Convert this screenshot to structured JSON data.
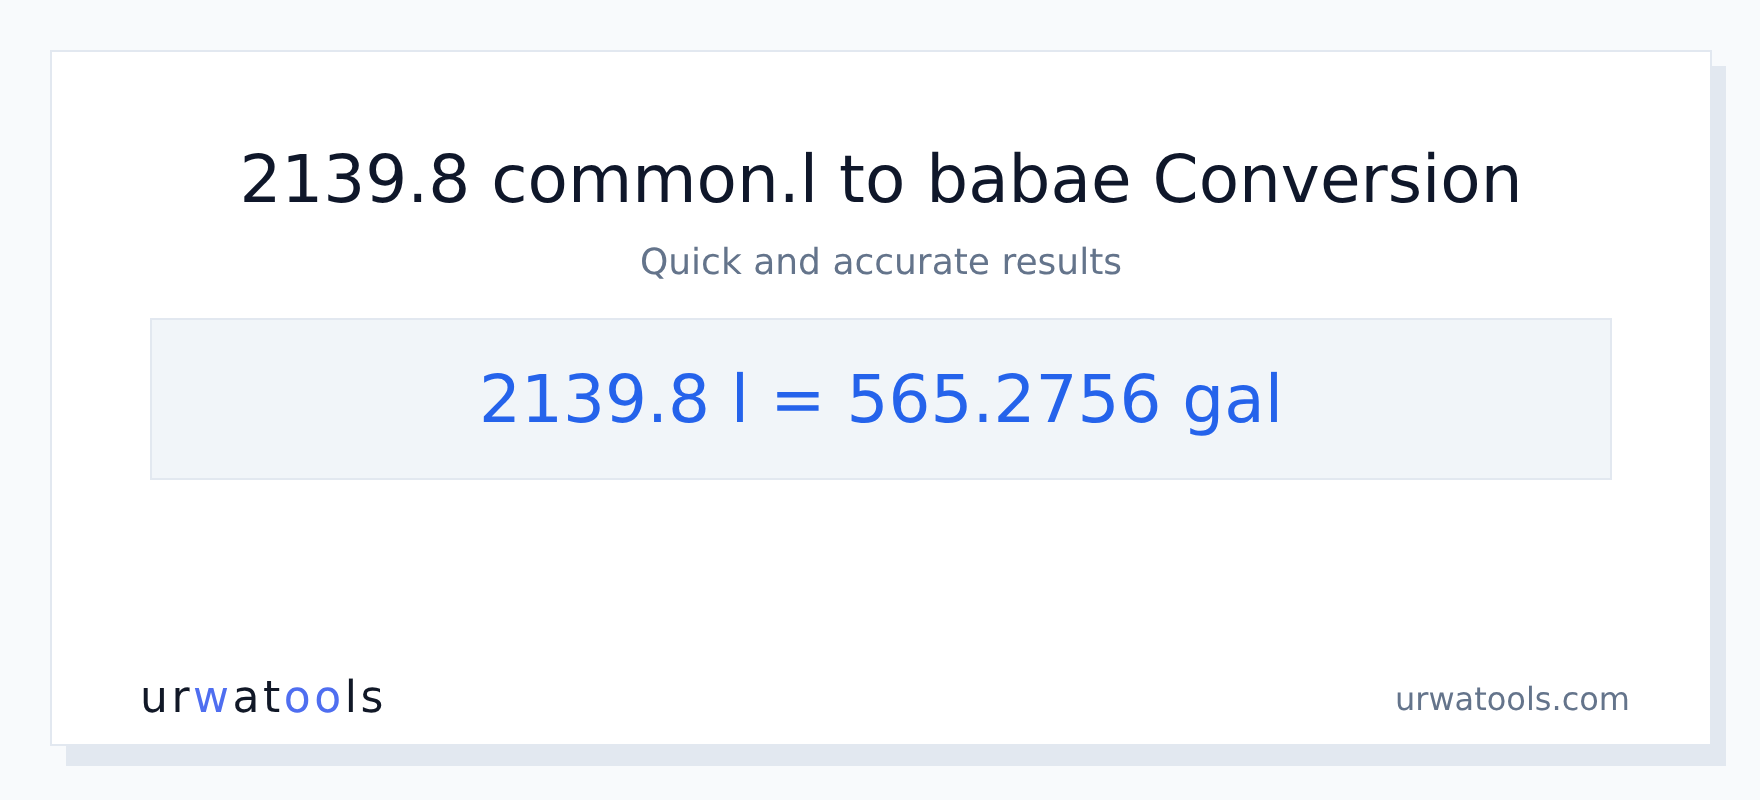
{
  "title": "2139.8 common.l to babae Conversion",
  "subtitle": "Quick and accurate results",
  "result": "2139.8 l = 565.2756 gal",
  "logo": [
    {
      "text": "ur",
      "accent": false
    },
    {
      "text": "w",
      "accent": true
    },
    {
      "text": "at",
      "accent": false
    },
    {
      "text": "oo",
      "accent": true
    },
    {
      "text": "ls",
      "accent": false
    }
  ],
  "site": "urwatools.com"
}
